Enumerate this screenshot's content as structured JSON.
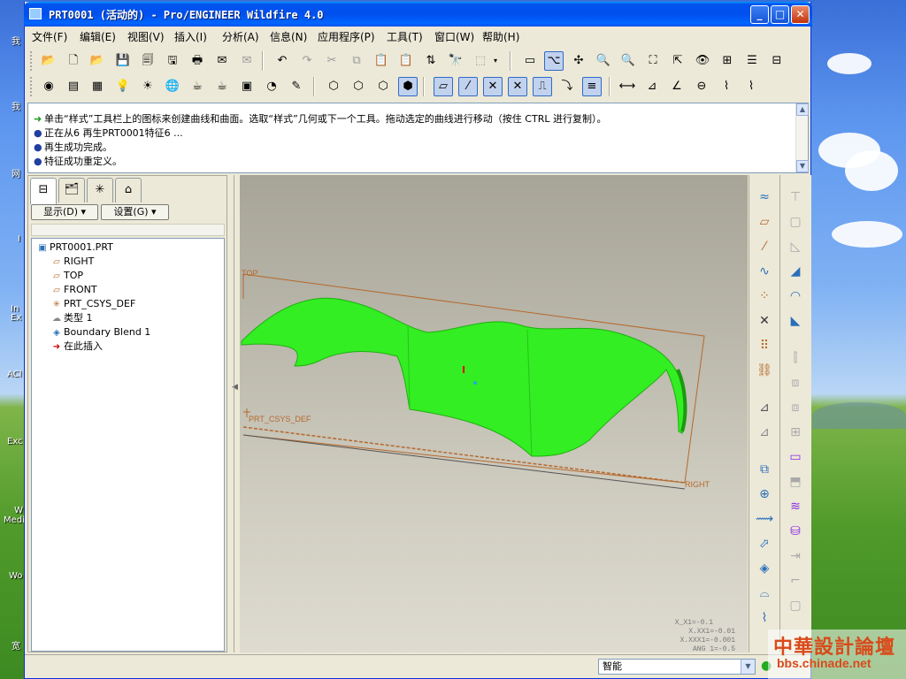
{
  "window": {
    "title": "PRT0001 (活动的) - Pro/ENGINEER Wildfire 4.0",
    "minimize": "_",
    "maximize": "□",
    "close": "✕"
  },
  "desktop": {
    "labels": [
      "我",
      "我",
      "网",
      "I",
      "In Ex",
      "ACI",
      "Exc",
      "W Medi",
      "Wo",
      "宽"
    ]
  },
  "menu": [
    "文件(F)",
    "编辑(E)",
    "视图(V)",
    "插入(I)",
    "分析(A)",
    "信息(N)",
    "应用程序(P)",
    "工具(T)",
    "窗口(W)",
    "帮助(H)"
  ],
  "messages": [
    {
      "icon": "arrow",
      "text": "单击“样式”工具栏上的图标来创建曲线和曲面。选取“样式”几何或下一个工具。拖动选定的曲线进行移动（按住 CTRL 进行复制）。"
    },
    {
      "icon": "bullet",
      "text": "正在从6 再生PRT0001特征6 ..."
    },
    {
      "icon": "bullet",
      "text": "再生成功完成。"
    },
    {
      "icon": "bullet",
      "text": "特征成功重定义。"
    }
  ],
  "nav": {
    "display_btn": "显示(D) ▾",
    "settings_btn": "设置(G) ▾"
  },
  "tree": [
    {
      "icon": "part-icon",
      "label": "PRT0001.PRT"
    },
    {
      "icon": "datum-plane-icon",
      "label": "RIGHT"
    },
    {
      "icon": "datum-plane-icon",
      "label": "TOP"
    },
    {
      "icon": "datum-plane-icon",
      "label": "FRONT"
    },
    {
      "icon": "csys-icon",
      "label": "PRT_CSYS_DEF"
    },
    {
      "icon": "style-feature-icon",
      "label": "类型 1"
    },
    {
      "icon": "boundary-blend-icon",
      "label": "Boundary Blend 1"
    },
    {
      "icon": "insert-here-arrow-icon",
      "label": "在此插入"
    }
  ],
  "viewport": {
    "datum_labels": {
      "top": "TOP",
      "csys": "PRT_CSYS_DEF",
      "right": "RIGHT"
    },
    "readouts": [
      "X_X1=-0.1",
      "X.XX1=-0.01",
      "X.XXX1=-0.001",
      "ANG 1=-0.5"
    ],
    "surface_color": "#33ee22",
    "datum_color": "#b5692c"
  },
  "status": {
    "smart_filter": "智能"
  },
  "watermark": {
    "line1": "中華設計論壇",
    "line2": "bbs.chinade.net"
  }
}
